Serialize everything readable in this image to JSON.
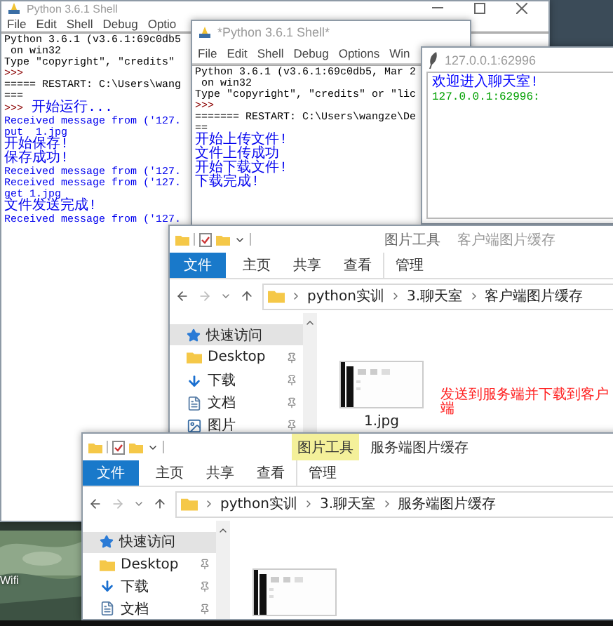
{
  "desktop": {
    "icon_label": "Wifi"
  },
  "shell_back": {
    "title": "Python 3.6.1 Shell",
    "menu": [
      "File",
      "Edit",
      "Shell",
      "Debug",
      "Optio"
    ],
    "lines": [
      {
        "kind": "info",
        "text": "Python 3.6.1 (v3.6.1:69c0db5"
      },
      {
        "kind": "info",
        "text": " on win32"
      },
      {
        "kind": "info",
        "text": "Type \"copyright\", \"credits\""
      },
      {
        "kind": "prompt",
        "text": ">>>"
      },
      {
        "kind": "info",
        "text": "===== RESTART: C:\\Users\\wang"
      },
      {
        "kind": "info",
        "text": "==="
      },
      {
        "kind": "prompted",
        "prompt": ">>>",
        "text": "开始运行..."
      },
      {
        "kind": "output",
        "text": "Received message from ('127."
      },
      {
        "kind": "output",
        "text": "put  1.jpg"
      },
      {
        "kind": "output",
        "text": "开始保存!"
      },
      {
        "kind": "output",
        "text": "保存成功!"
      },
      {
        "kind": "output",
        "text": "Received message from ('127."
      },
      {
        "kind": "output",
        "text": "Received message from ('127."
      },
      {
        "kind": "output",
        "text": "get 1.jpg"
      },
      {
        "kind": "output",
        "text": "文件发送完成!"
      },
      {
        "kind": "output",
        "text": "Received message from ('127."
      }
    ]
  },
  "shell_front": {
    "title": "*Python 3.6.1 Shell*",
    "menu": [
      "File",
      "Edit",
      "Shell",
      "Debug",
      "Options",
      "Win"
    ],
    "lines": [
      {
        "kind": "info",
        "text": "Python 3.6.1 (v3.6.1:69c0db5, Mar 2"
      },
      {
        "kind": "info",
        "text": " on win32"
      },
      {
        "kind": "info",
        "text": "Type \"copyright\", \"credits\" or \"lic"
      },
      {
        "kind": "prompt",
        "text": ">>>"
      },
      {
        "kind": "info",
        "text": "======= RESTART: C:\\Users\\wangze\\De"
      },
      {
        "kind": "info",
        "text": "=="
      },
      {
        "kind": "output",
        "text": "开始上传文件!"
      },
      {
        "kind": "output",
        "text": "文件上传成功"
      },
      {
        "kind": "output",
        "text": "开始下载文件!"
      },
      {
        "kind": "output",
        "text": "下载完成!"
      }
    ]
  },
  "chat": {
    "title": "127.0.0.1:62996",
    "lines": [
      {
        "text": "欢迎进入聊天室!",
        "color": "#0000ff"
      },
      {
        "text": "127.0.0.1:62996:",
        "color": "#00a000"
      }
    ]
  },
  "explorers": [
    {
      "context_tab": "图片工具",
      "active": false,
      "title": "客户端图片缓存",
      "tabs": [
        {
          "label": "文件",
          "kind": "file"
        },
        {
          "label": "主页",
          "kind": "tab"
        },
        {
          "label": "共享",
          "kind": "tab"
        },
        {
          "label": "查看",
          "kind": "tab"
        },
        {
          "label": "管理",
          "kind": "contextual"
        }
      ],
      "path": [
        "python实训",
        "3.聊天室",
        "客户端图片缓存"
      ],
      "nav": [
        {
          "label": "快速访问",
          "kind": "star",
          "selected": true,
          "pinned": false
        },
        {
          "label": "Desktop",
          "kind": "folder",
          "selected": false,
          "pinned": true
        },
        {
          "label": "下载",
          "kind": "download",
          "selected": false,
          "pinned": true
        },
        {
          "label": "文档",
          "kind": "document",
          "selected": false,
          "pinned": true
        },
        {
          "label": "图片",
          "kind": "picture",
          "selected": false,
          "pinned": true
        }
      ],
      "files": [
        {
          "name": "1.jpg",
          "kind": "picture"
        }
      ],
      "annotation": "发送到服务端并下载到客户端"
    },
    {
      "context_tab": "图片工具",
      "active": true,
      "title": "服务端图片缓存",
      "tabs": [
        {
          "label": "文件",
          "kind": "file"
        },
        {
          "label": "主页",
          "kind": "tab"
        },
        {
          "label": "共享",
          "kind": "tab"
        },
        {
          "label": "查看",
          "kind": "tab"
        },
        {
          "label": "管理",
          "kind": "contextual"
        }
      ],
      "path": [
        "python实训",
        "3.聊天室",
        "服务端图片缓存"
      ],
      "nav": [
        {
          "label": "快速访问",
          "kind": "star",
          "selected": true,
          "pinned": false
        },
        {
          "label": "Desktop",
          "kind": "folder",
          "selected": false,
          "pinned": true
        },
        {
          "label": "下载",
          "kind": "download",
          "selected": false,
          "pinned": true
        },
        {
          "label": "文档",
          "kind": "document",
          "selected": false,
          "pinned": true
        }
      ],
      "files": [
        {
          "kind": "picture"
        }
      ]
    }
  ]
}
